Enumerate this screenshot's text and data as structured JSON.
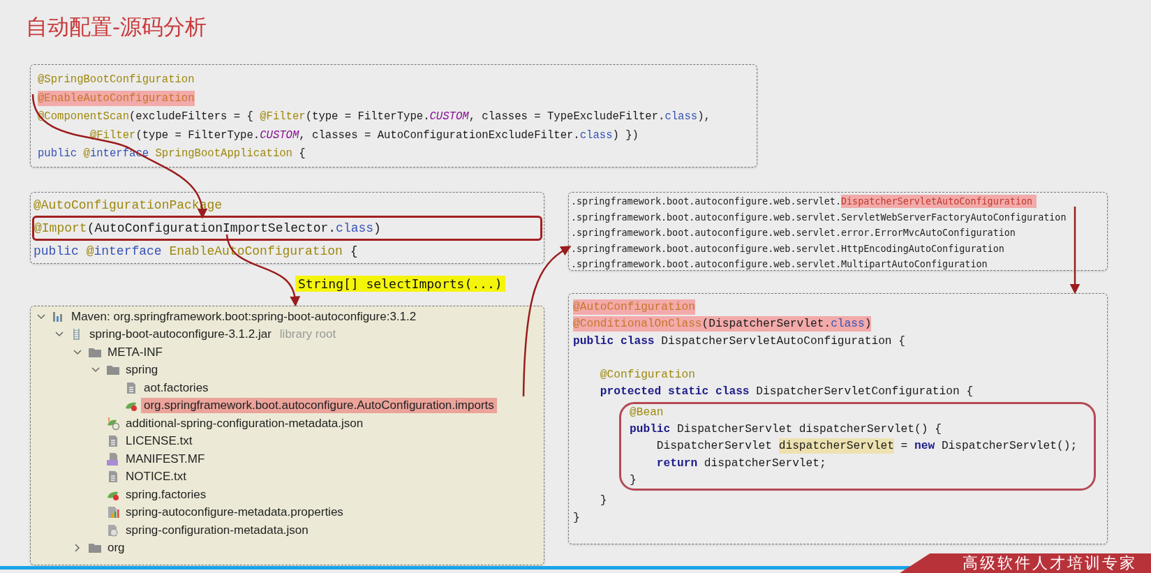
{
  "title": "自动配置-源码分析",
  "application_code": {
    "lines": [
      {
        "boxed": false,
        "tokens": [
          {
            "kind": "annotation",
            "text": "@SpringBootConfiguration"
          }
        ]
      },
      {
        "boxed": false,
        "tokens": [
          {
            "kind": "marked_annotation",
            "text": "@EnableAutoConfiguration"
          }
        ]
      },
      {
        "boxed": false,
        "tokens": [
          {
            "kind": "annotation",
            "text": "@ComponentScan"
          },
          {
            "kind": "plain",
            "text": "(excludeFilters = { "
          },
          {
            "kind": "annotation",
            "text": "@Filter"
          },
          {
            "kind": "plain",
            "text": "(type = FilterType."
          },
          {
            "kind": "constant",
            "text": "CUSTOM"
          },
          {
            "kind": "plain",
            "text": ", classes = TypeExcludeFilter."
          },
          {
            "kind": "keyword",
            "text": "class"
          },
          {
            "kind": "plain",
            "text": "),"
          }
        ]
      },
      {
        "boxed": false,
        "tokens": [
          {
            "kind": "annotation",
            "text": "        @Filter"
          },
          {
            "kind": "plain",
            "text": "(type = FilterType."
          },
          {
            "kind": "constant",
            "text": "CUSTOM"
          },
          {
            "kind": "plain",
            "text": ", classes = AutoConfigurationExcludeFilter."
          },
          {
            "kind": "keyword",
            "text": "class"
          },
          {
            "kind": "plain",
            "text": ") })"
          }
        ]
      },
      {
        "boxed": false,
        "tokens": [
          {
            "kind": "keyword",
            "text": "public "
          },
          {
            "kind": "annotation",
            "text": "@"
          },
          {
            "kind": "keyword",
            "text": "interface "
          },
          {
            "kind": "annotation",
            "text": "SpringBootApplication"
          },
          {
            "kind": "plain",
            "text": " {"
          }
        ]
      }
    ]
  },
  "enable_code": {
    "lines": [
      {
        "boxed": false,
        "tokens": [
          {
            "kind": "annotation",
            "text": "@AutoConfigurationPackage"
          }
        ]
      },
      {
        "boxed": true,
        "tokens": [
          {
            "kind": "annotation",
            "text": "@Import"
          },
          {
            "kind": "plain",
            "text": "(AutoConfigurationImportSelector."
          },
          {
            "kind": "keyword",
            "text": "class"
          },
          {
            "kind": "plain",
            "text": ")"
          }
        ]
      },
      {
        "boxed": false,
        "tokens": [
          {
            "kind": "keyword",
            "text": "public "
          },
          {
            "kind": "annotation",
            "text": "@"
          },
          {
            "kind": "keyword",
            "text": "interface "
          },
          {
            "kind": "annotation",
            "text": "EnableAutoConfiguration"
          },
          {
            "kind": "plain",
            "text": " {"
          }
        ]
      }
    ]
  },
  "method_label": "String[] selectImports(...)",
  "file_tree": {
    "items": [
      {
        "label": "Maven: org.springframework.boot:spring-boot-autoconfigure:3.1.2",
        "kind": "library",
        "selected": false,
        "expanded": true,
        "children": [
          {
            "label": "spring-boot-autoconfigure-3.1.2.jar",
            "hint": "library root",
            "kind": "jar",
            "selected": false,
            "expanded": true,
            "children": [
              {
                "label": "META-INF",
                "kind": "folder",
                "selected": false,
                "expanded": true,
                "children": [
                  {
                    "label": "spring",
                    "kind": "folder",
                    "selected": false,
                    "expanded": true,
                    "children": [
                      {
                        "label": "aot.factories",
                        "kind": "text",
                        "selected": false
                      },
                      {
                        "label": "org.springframework.boot.autoconfigure.AutoConfiguration.imports",
                        "kind": "spring",
                        "selected": true
                      }
                    ]
                  },
                  {
                    "label": "additional-spring-configuration-metadata.json",
                    "kind": "spring_json",
                    "selected": false
                  },
                  {
                    "label": "LICENSE.txt",
                    "kind": "text",
                    "selected": false
                  },
                  {
                    "label": "MANIFEST.MF",
                    "kind": "manifest",
                    "selected": false
                  },
                  {
                    "label": "NOTICE.txt",
                    "kind": "text",
                    "selected": false
                  },
                  {
                    "label": "spring.factories",
                    "kind": "spring",
                    "selected": false
                  },
                  {
                    "label": "spring-autoconfigure-metadata.properties",
                    "kind": "properties",
                    "selected": false
                  },
                  {
                    "label": "spring-configuration-metadata.json",
                    "kind": "json",
                    "selected": false
                  }
                ]
              },
              {
                "label": "org",
                "kind": "folder",
                "selected": false,
                "expanded": false
              }
            ]
          }
        ]
      }
    ]
  },
  "imports_list": {
    "lines": [
      {
        "prefix": ".springframework.boot.autoconfigure.web.servlet.",
        "name": "DispatcherServletAutoConfiguration",
        "marked": true
      },
      {
        "prefix": ".springframework.boot.autoconfigure.web.servlet.",
        "name": "ServletWebServerFactoryAutoConfiguration",
        "marked": false
      },
      {
        "prefix": ".springframework.boot.autoconfigure.web.servlet.",
        "name": "error.ErrorMvcAutoConfiguration",
        "marked": false
      },
      {
        "prefix": ".springframework.boot.autoconfigure.web.servlet.",
        "name": "HttpEncodingAutoConfiguration",
        "marked": false
      },
      {
        "prefix": ".springframework.boot.autoconfigure.web.servlet.",
        "name": "MultipartAutoConfiguration",
        "marked": false
      }
    ]
  },
  "dispatcher_code": {
    "lines": [
      {
        "boxed": false,
        "tokens": [
          {
            "kind": "marked_annotation",
            "text": "@AutoConfiguration"
          }
        ]
      },
      {
        "boxed": false,
        "tokens": [
          {
            "kind": "marked_annotation",
            "text": "@ConditionalOnClass"
          },
          {
            "kind": "marked_plain",
            "text": "(DispatcherServlet."
          },
          {
            "kind": "marked_keyword",
            "text": "class"
          },
          {
            "kind": "marked_plain",
            "text": ")"
          }
        ]
      },
      {
        "boxed": false,
        "tokens": [
          {
            "kind": "keyword_bold",
            "text": "public class "
          },
          {
            "kind": "plain",
            "text": "DispatcherServletAutoConfiguration {"
          }
        ]
      },
      {
        "boxed": false,
        "tokens": [
          {
            "kind": "annotation",
            "text": "    @Configuration"
          }
        ]
      },
      {
        "boxed": false,
        "tokens": [
          {
            "kind": "keyword_bold",
            "text": "    protected static class "
          },
          {
            "kind": "plain",
            "text": "DispatcherServletConfiguration {"
          }
        ]
      },
      {
        "boxed": true,
        "tokens": [
          {
            "kind": "annotation",
            "text": "@Bean"
          }
        ]
      },
      {
        "boxed": true,
        "tokens": [
          {
            "kind": "keyword_bold",
            "text": "public "
          },
          {
            "kind": "plain",
            "text": "DispatcherServlet dispatcherServlet() {"
          }
        ]
      },
      {
        "boxed": true,
        "tokens": [
          {
            "kind": "plain",
            "text": "    DispatcherServlet "
          },
          {
            "kind": "variable_highlight",
            "text": "dispatcherServlet"
          },
          {
            "kind": "plain",
            "text": " = "
          },
          {
            "kind": "keyword_bold",
            "text": "new "
          },
          {
            "kind": "plain",
            "text": "DispatcherServlet();"
          }
        ]
      },
      {
        "boxed": true,
        "tokens": [
          {
            "kind": "keyword_bold",
            "text": "    return "
          },
          {
            "kind": "plain",
            "text": "dispatcherServlet;"
          }
        ]
      },
      {
        "boxed": true,
        "tokens": [
          {
            "kind": "plain",
            "text": "}"
          }
        ]
      },
      {
        "boxed": false,
        "tokens": [
          {
            "kind": "plain",
            "text": "    }"
          }
        ]
      },
      {
        "boxed": false,
        "tokens": [
          {
            "kind": "plain",
            "text": "}"
          }
        ]
      }
    ]
  },
  "banner": "高级软件人才培训专家"
}
